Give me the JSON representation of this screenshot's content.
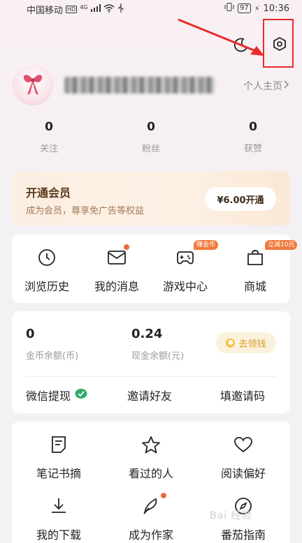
{
  "status_bar": {
    "carrier": "中国移动",
    "network": "HD",
    "signal": "4G",
    "battery": "97",
    "time": "10:36"
  },
  "top_bar": {
    "icons": [
      "moon-icon",
      "settings-hexagon-icon"
    ]
  },
  "profile": {
    "homepage_label": "个人主页",
    "stats": [
      {
        "value": "0",
        "label": "关注"
      },
      {
        "value": "0",
        "label": "粉丝"
      },
      {
        "value": "0",
        "label": "获赞"
      }
    ]
  },
  "vip": {
    "title": "开通会员",
    "subtitle": "成为会员，尊享免广告等权益",
    "button": "¥6.00开通"
  },
  "quick_menu": [
    {
      "label": "浏览历史",
      "icon": "clock-icon"
    },
    {
      "label": "我的消息",
      "icon": "mail-icon",
      "dot": true
    },
    {
      "label": "游戏中心",
      "icon": "gamepad-icon",
      "tag": "赚金币"
    },
    {
      "label": "商城",
      "icon": "shop-icon",
      "tag": "立减10元"
    }
  ],
  "wallet": {
    "coin_value": "0",
    "coin_label": "金币余额(币)",
    "cash_value": "0.24",
    "cash_label": "现金余额(元)",
    "get_money_button": "去领钱",
    "wechat_withdraw": "微信提现",
    "invite_friends": "邀请好友",
    "enter_invite_code": "填邀请码"
  },
  "tools": [
    {
      "label": "笔记书摘",
      "icon": "note-icon"
    },
    {
      "label": "看过的人",
      "icon": "star-icon"
    },
    {
      "label": "阅读偏好",
      "icon": "heart-icon"
    },
    {
      "label": "我的下载",
      "icon": "download-icon"
    },
    {
      "label": "成为作家",
      "icon": "quill-icon",
      "dot": true
    },
    {
      "label": "番茄指南",
      "icon": "compass-icon"
    }
  ],
  "colors": {
    "accent_orange": "#f06a3a",
    "wechat_green": "#2aae67",
    "highlight_red": "#ea2a2a"
  },
  "watermark": "Bai 经验"
}
